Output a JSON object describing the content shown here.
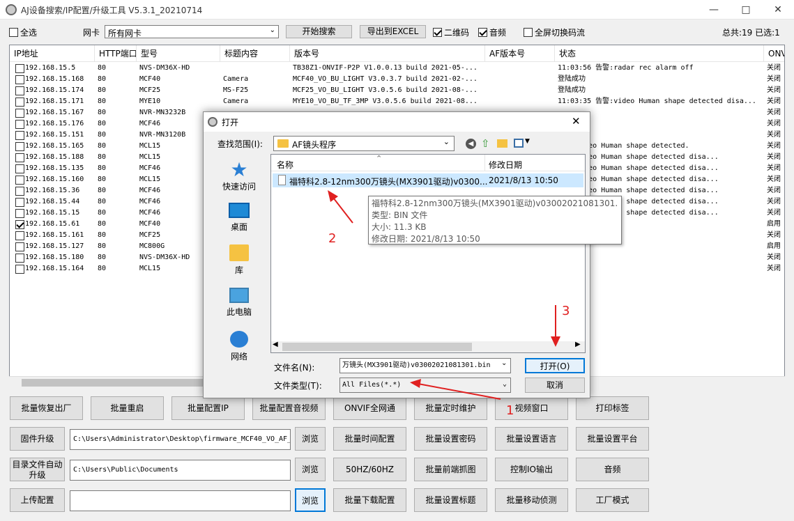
{
  "app": {
    "title": "AJ设备搜索/IP配置/升级工具 V5.3.1_20210714"
  },
  "toolbar": {
    "select_all": "全选",
    "nic_label": "网卡",
    "nic_value": "所有网卡",
    "start_search": "开始搜索",
    "export_excel": "导出到EXCEL",
    "qrcode": "二维码",
    "audio": "音频",
    "fullscreen_switch": "全屏切换码流",
    "total": "总共:19 已选:1"
  },
  "table": {
    "columns": [
      "IP地址",
      "HTTP端口",
      "型号",
      "标题内容",
      "版本号",
      "AF版本号",
      "状态",
      "ONVI"
    ],
    "rows": [
      {
        "checked": false,
        "ip": "192.168.15.5",
        "port": "80",
        "model": "NVS-DM36X-HD",
        "title": "",
        "version": "TB38Z1-ONVIF-P2P V1.0.0.13 build 2021-05-...",
        "af": "",
        "status": "11:03:56 告警:radar rec alarm off",
        "onvif": "关闭"
      },
      {
        "checked": false,
        "ip": "192.168.15.168",
        "port": "80",
        "model": "MCF40",
        "title": "Camera",
        "version": "MCF40_VO_BU_LIGHT V3.0.3.7 build 2021-02-...",
        "af": "",
        "status": "登陆成功",
        "onvif": "关闭"
      },
      {
        "checked": false,
        "ip": "192.168.15.174",
        "port": "80",
        "model": "MCF25",
        "title": "MS-F25",
        "version": "MCF25_VO_BU_LIGHT V3.0.5.6 build 2021-08-...",
        "af": "",
        "status": "登陆成功",
        "onvif": "关闭"
      },
      {
        "checked": false,
        "ip": "192.168.15.171",
        "port": "80",
        "model": "MYE10",
        "title": "Camera",
        "version": "MYE10_VO_BU_TF_3MP V3.0.5.6 build 2021-08...",
        "af": "",
        "status": "11:03:35 告警:video Human shape detected disa...",
        "onvif": "关闭"
      },
      {
        "checked": false,
        "ip": "192.168.15.167",
        "port": "80",
        "model": "NVR-MN3232B",
        "title": "",
        "version": "",
        "af": "",
        "status": "",
        "onvif": "关闭"
      },
      {
        "checked": false,
        "ip": "192.168.15.176",
        "port": "80",
        "model": "MCF46",
        "title": "",
        "version": "",
        "af": "",
        "status": "",
        "onvif": "关闭"
      },
      {
        "checked": false,
        "ip": "192.168.15.151",
        "port": "80",
        "model": "NVR-MN3120B",
        "title": "",
        "version": "",
        "af": "",
        "status": "",
        "onvif": "关闭"
      },
      {
        "checked": false,
        "ip": "192.168.15.165",
        "port": "80",
        "model": "MCL15",
        "title": "",
        "version": "",
        "af": "",
        "status": "告警:video Human shape detected.",
        "onvif": "关闭"
      },
      {
        "checked": false,
        "ip": "192.168.15.188",
        "port": "80",
        "model": "MCL15",
        "title": "",
        "version": "",
        "af": "",
        "status": "告警:video Human shape detected disa...",
        "onvif": "关闭"
      },
      {
        "checked": false,
        "ip": "192.168.15.135",
        "port": "80",
        "model": "MCF46",
        "title": "",
        "version": "",
        "af": "",
        "status": "告警:video Human shape detected disa...",
        "onvif": "关闭"
      },
      {
        "checked": false,
        "ip": "192.168.15.160",
        "port": "80",
        "model": "MCL15",
        "title": "",
        "version": "",
        "af": "",
        "status": "告警:video Human shape detected disa...",
        "onvif": "关闭"
      },
      {
        "checked": false,
        "ip": "192.168.15.36",
        "port": "80",
        "model": "MCF46",
        "title": "",
        "version": "",
        "af": "",
        "status": "告警:video Human shape detected disa...",
        "onvif": "关闭"
      },
      {
        "checked": false,
        "ip": "192.168.15.44",
        "port": "80",
        "model": "MCF46",
        "title": "",
        "version": "",
        "af": "",
        "status": "告警:video Human shape detected disa...",
        "onvif": "关闭"
      },
      {
        "checked": false,
        "ip": "192.168.15.15",
        "port": "80",
        "model": "MCF46",
        "title": "",
        "version": "",
        "af": "",
        "status": "告警:video Human shape detected disa...",
        "onvif": "关闭"
      },
      {
        "checked": true,
        "ip": "192.168.15.61",
        "port": "80",
        "model": "MCF40",
        "title": "",
        "version": "",
        "af": "",
        "status": "",
        "onvif": "启用"
      },
      {
        "checked": false,
        "ip": "192.168.15.161",
        "port": "80",
        "model": "MCF25",
        "title": "",
        "version": "",
        "af": "",
        "status": "",
        "onvif": "关闭"
      },
      {
        "checked": false,
        "ip": "192.168.15.127",
        "port": "80",
        "model": "MC800G",
        "title": "",
        "version": "",
        "af": "",
        "status": "",
        "onvif": "启用"
      },
      {
        "checked": false,
        "ip": "192.168.15.180",
        "port": "80",
        "model": "NVS-DM36X-HD",
        "title": "",
        "version": "",
        "af": "",
        "status": "",
        "onvif": "关闭"
      },
      {
        "checked": false,
        "ip": "192.168.15.164",
        "port": "80",
        "model": "MCL15",
        "title": "",
        "version": "",
        "af": "",
        "status": "",
        "onvif": "关闭"
      }
    ]
  },
  "buttons": {
    "row1": [
      "批量恢复出厂",
      "批量重启",
      "批量配置IP",
      "批量配置音视频",
      "ONVIF全网通",
      "批量定时维护",
      "视频窗口",
      "打印标签"
    ],
    "firmware_upgrade": "固件升级",
    "firmware_path": "C:\\Users\\Administrator\\Desktop\\firmware_MCF40_VO_AF_",
    "browse": "浏览",
    "row2": [
      "批量时间配置",
      "批量设置密码",
      "批量设置语言",
      "批量设置平台"
    ],
    "dir_upgrade": "目录文件自动升级",
    "dir_path": "C:\\Users\\Public\\Documents",
    "row3": [
      "50HZ/60HZ",
      "批量前端抓图",
      "控制IO输出",
      "音频"
    ],
    "upload_config": "上传配置",
    "upload_path": "",
    "row4": [
      "批量下载配置",
      "批量设置标题",
      "批量移动侦测",
      "工厂模式"
    ]
  },
  "dialog": {
    "title": "打开",
    "lookin_label": "查找范围(I):",
    "lookin_value": "AF镜头程序",
    "places": [
      "快速访问",
      "桌面",
      "库",
      "此电脑",
      "网络"
    ],
    "col_name": "名称",
    "col_date": "修改日期",
    "file_name": "福特科2.8-12nm300万镜头(MX3901驱动)v0300...",
    "file_date": "2021/8/13 10:50",
    "tooltip": {
      "name": "福特科2.8-12nm300万镜头(MX3901驱动)v03002021081301.bin",
      "type": "类型: BIN 文件",
      "size": "大小: 11.3 KB",
      "modified": "修改日期: 2021/8/13 10:50"
    },
    "filename_label": "文件名(N):",
    "filename_value": "万镜头(MX3901驱动)v03002021081301.bin",
    "filetype_label": "文件类型(T):",
    "filetype_value": "All Files(*.*)",
    "open": "打开(O)",
    "cancel": "取消"
  },
  "annotations": [
    "1",
    "2",
    "3"
  ],
  "colors": {
    "accent": "#0078d7",
    "selected_row": "#cce8ff",
    "annotation": "#e02020",
    "folder": "#f5c242"
  }
}
